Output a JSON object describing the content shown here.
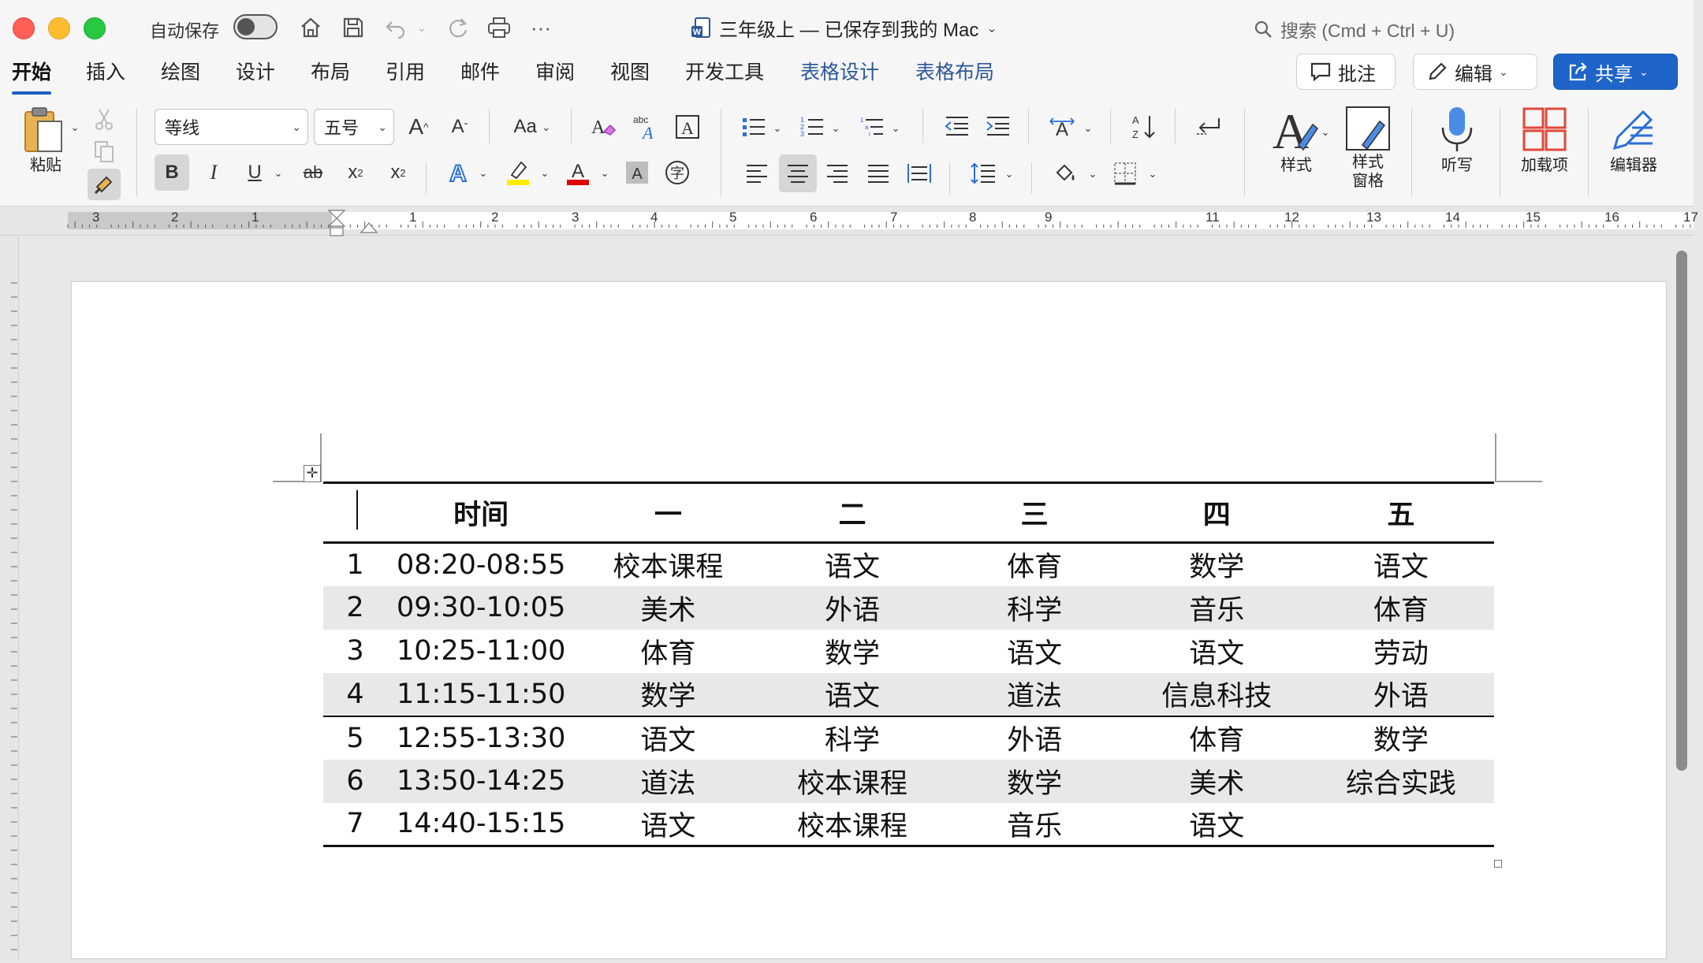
{
  "titlebar": {
    "autosave_label": "自动保存",
    "doc_title": "三年级上 — 已保存到我的 Mac",
    "search_placeholder": "搜索 (Cmd + Ctrl + U)"
  },
  "tabs": [
    "开始",
    "插入",
    "绘图",
    "设计",
    "布局",
    "引用",
    "邮件",
    "审阅",
    "视图",
    "开发工具",
    "表格设计",
    "表格布局"
  ],
  "actions": {
    "comments_label": "批注",
    "editing_label": "编辑",
    "share_label": "共享"
  },
  "ribbon": {
    "paste_label": "粘贴",
    "font_name": "等线",
    "font_size": "五号",
    "grow_font": "A",
    "shrink_font": "A",
    "change_case": "Aa",
    "bold": "B",
    "italic": "I",
    "underline": "U",
    "strikethrough": "ab",
    "subscript": "x",
    "superscript": "x",
    "phonetic": "字",
    "styles_label": "样式",
    "styles_pane_label": "样式\n窗格",
    "dictate_label": "听写",
    "addins_label": "加载项",
    "editor_label": "编辑器"
  },
  "ruler": {
    "numbers": [
      "3",
      "2",
      "1",
      "1",
      "2",
      "3",
      "4",
      "5",
      "6",
      "7",
      "8",
      "9",
      "11",
      "12",
      "13",
      "14",
      "15",
      "16",
      "17"
    ]
  },
  "table": {
    "headers": [
      "",
      "时间",
      "一",
      "二",
      "三",
      "四",
      "五"
    ],
    "rows": [
      [
        "1",
        "08:20-08:55",
        "校本课程",
        "语文",
        "体育",
        "数学",
        "语文"
      ],
      [
        "2",
        "09:30-10:05",
        "美术",
        "外语",
        "科学",
        "音乐",
        "体育"
      ],
      [
        "3",
        "10:25-11:00",
        "体育",
        "数学",
        "语文",
        "语文",
        "劳动"
      ],
      [
        "4",
        "11:15-11:50",
        "数学",
        "语文",
        "道法",
        "信息科技",
        "外语"
      ],
      [
        "5",
        "12:55-13:30",
        "语文",
        "科学",
        "外语",
        "体育",
        "数学"
      ],
      [
        "6",
        "13:50-14:25",
        "道法",
        "校本课程",
        "数学",
        "美术",
        "综合实践"
      ],
      [
        "7",
        "14:40-15:15",
        "语文",
        "校本课程",
        "音乐",
        "语文",
        ""
      ]
    ]
  },
  "colors": {
    "accent": "#1f64c8",
    "contextual_tab": "#2b579a",
    "row_shade": "#e8e8e8"
  }
}
